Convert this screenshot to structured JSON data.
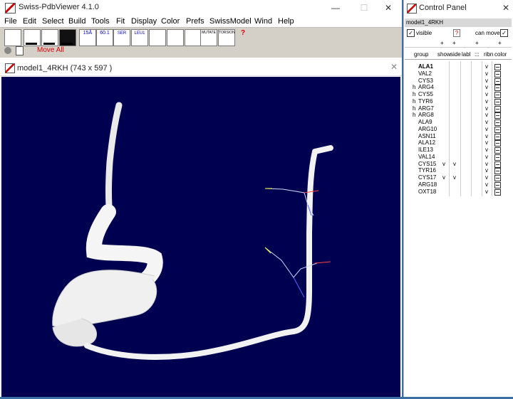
{
  "app": {
    "title": "Swiss-PdbViewer 4.1.0",
    "minimize": "—",
    "maximize": "☐",
    "close": "✕"
  },
  "menu": [
    "File",
    "Edit",
    "Select",
    "Build",
    "Tools",
    "Fit",
    "Display",
    "Color",
    "Prefs",
    "SwissModel",
    "Wind",
    "Help"
  ],
  "toolbar": {
    "buttons": [
      "15Å",
      "60.1",
      "SER",
      "LEU1",
      "MUTATE",
      "TORSION",
      "?"
    ],
    "move_all": "Move All"
  },
  "model_window": {
    "title": "model1_4RKH  (743 x 597 )",
    "close": "✕",
    "background": "#000050"
  },
  "control_panel": {
    "title": "Control Panel",
    "close": "✕",
    "model_name": "model1_4RKH",
    "visible_label": "visible",
    "can_move_label": "can move",
    "help": "?",
    "headers": [
      "group",
      "show",
      "side",
      "labl",
      ":::",
      "ribn",
      "color"
    ],
    "header_marks": [
      "+",
      "-",
      "+",
      "-",
      "+",
      "-",
      "+"
    ],
    "residues": [
      {
        "h": "",
        "name": "ALA1",
        "show": "",
        "side": "",
        "ribn": "v",
        "bold": true
      },
      {
        "h": "",
        "name": "VAL2",
        "show": "",
        "side": "",
        "ribn": "v"
      },
      {
        "h": "",
        "name": "CYS3",
        "show": "",
        "side": "",
        "ribn": "v"
      },
      {
        "h": "h",
        "name": "ARG4",
        "show": "",
        "side": "",
        "ribn": "v"
      },
      {
        "h": "h",
        "name": "CYS5",
        "show": "",
        "side": "",
        "ribn": "v"
      },
      {
        "h": "h",
        "name": "TYR6",
        "show": "",
        "side": "",
        "ribn": "v"
      },
      {
        "h": "h",
        "name": "ARG7",
        "show": "",
        "side": "",
        "ribn": "v"
      },
      {
        "h": "h",
        "name": "ARG8",
        "show": "",
        "side": "",
        "ribn": "v"
      },
      {
        "h": "",
        "name": "ALA9",
        "show": "",
        "side": "",
        "ribn": "v"
      },
      {
        "h": "",
        "name": "ARG10",
        "show": "",
        "side": "",
        "ribn": "v"
      },
      {
        "h": "",
        "name": "ASN11",
        "show": "",
        "side": "",
        "ribn": "v"
      },
      {
        "h": "",
        "name": "ALA12",
        "show": "",
        "side": "",
        "ribn": "v"
      },
      {
        "h": "",
        "name": "ILE13",
        "show": "",
        "side": "",
        "ribn": "v"
      },
      {
        "h": "",
        "name": "VAL14",
        "show": "",
        "side": "",
        "ribn": "v"
      },
      {
        "h": "",
        "name": "CYS15",
        "show": "v",
        "side": "v",
        "ribn": "v"
      },
      {
        "h": "",
        "name": "TYR16",
        "show": "",
        "side": "",
        "ribn": "v"
      },
      {
        "h": "",
        "name": "CYS17",
        "show": "v",
        "side": "v",
        "ribn": "v"
      },
      {
        "h": "",
        "name": "ARG18",
        "show": "",
        "side": "",
        "ribn": "v"
      },
      {
        "h": "",
        "name": "OXT18",
        "show": "",
        "side": "",
        "ribn": "v"
      }
    ]
  }
}
